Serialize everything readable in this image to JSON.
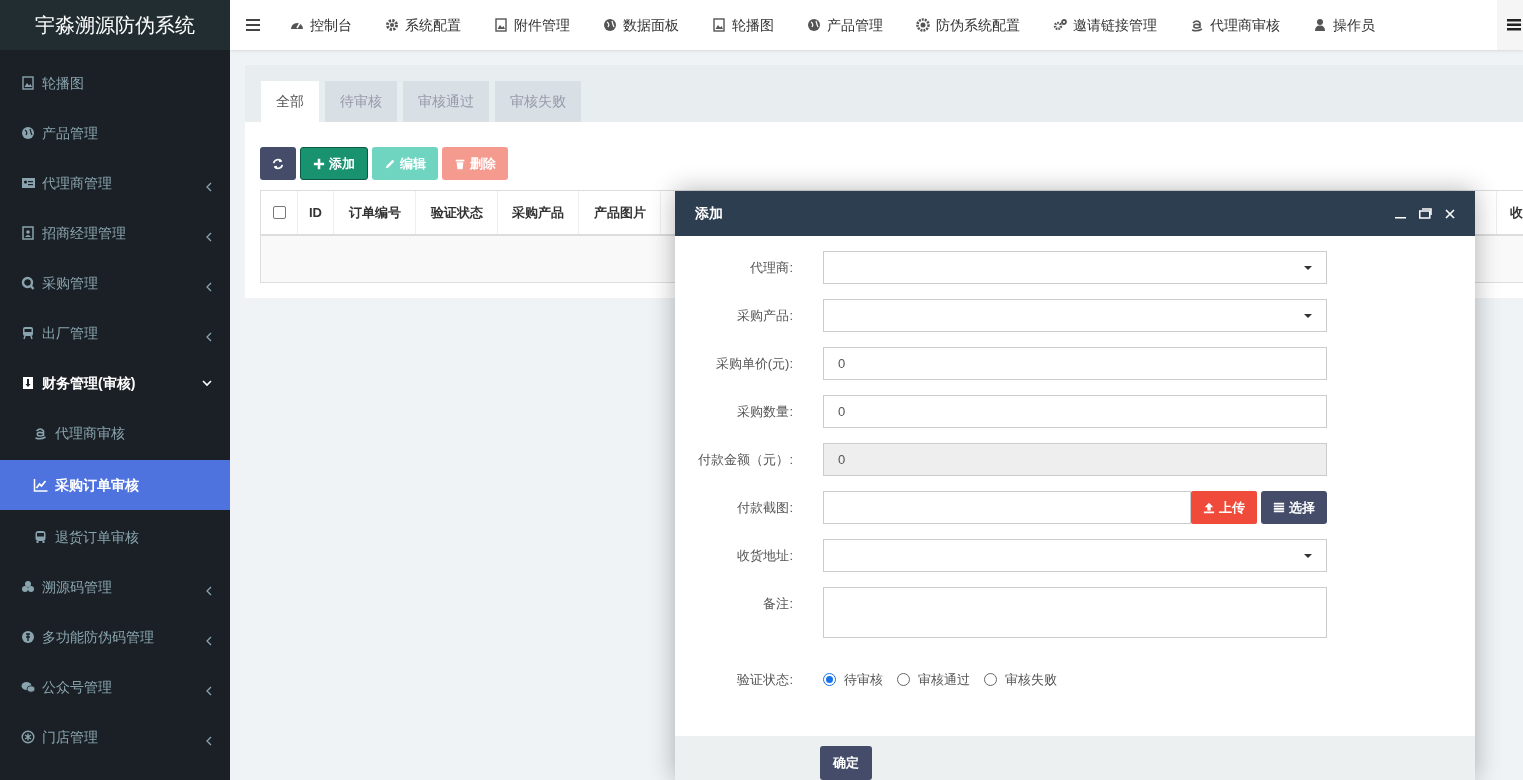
{
  "app_title": "宇淼溯源防伪系统",
  "top_nav": [
    {
      "label": "控制台"
    },
    {
      "label": "系统配置"
    },
    {
      "label": "附件管理"
    },
    {
      "label": "数据面板"
    },
    {
      "label": "轮播图"
    },
    {
      "label": "产品管理"
    },
    {
      "label": "防伪系统配置"
    },
    {
      "label": "邀请链接管理"
    },
    {
      "label": "代理商审核"
    },
    {
      "label": "操作员"
    }
  ],
  "sidebar": {
    "items": [
      {
        "kind": "link",
        "label": "轮播图"
      },
      {
        "kind": "link",
        "label": "产品管理"
      },
      {
        "kind": "group",
        "label": "代理商管理",
        "expanded": false
      },
      {
        "kind": "group",
        "label": "招商经理管理",
        "expanded": false
      },
      {
        "kind": "group",
        "label": "采购管理",
        "expanded": false
      },
      {
        "kind": "group",
        "label": "出厂管理",
        "expanded": false
      },
      {
        "kind": "group",
        "label": "财务管理(审核)",
        "expanded": true,
        "children": [
          {
            "label": "代理商审核",
            "selected": false
          },
          {
            "label": "采购订单审核",
            "selected": true
          },
          {
            "label": "退货订单审核",
            "selected": false
          }
        ]
      },
      {
        "kind": "group",
        "label": "溯源码管理",
        "expanded": false
      },
      {
        "kind": "group",
        "label": "多功能防伪码管理",
        "expanded": false
      },
      {
        "kind": "group",
        "label": "公众号管理",
        "expanded": false
      },
      {
        "kind": "group",
        "label": "门店管理",
        "expanded": false
      }
    ]
  },
  "tabs": [
    {
      "label": "全部",
      "selected": true
    },
    {
      "label": "待审核",
      "selected": false
    },
    {
      "label": "审核通过",
      "selected": false
    },
    {
      "label": "审核失败",
      "selected": false
    }
  ],
  "toolbar": [
    {
      "kind": "refresh",
      "disabled": false
    },
    {
      "kind": "add",
      "label": "添加",
      "disabled": false
    },
    {
      "kind": "edit",
      "label": "编辑",
      "disabled": true
    },
    {
      "kind": "delete",
      "label": "删除",
      "disabled": true
    }
  ],
  "table": {
    "select_all": {
      "checked": false
    },
    "columns": [
      "ID",
      "订单编号",
      "验证状态",
      "采购产品",
      "产品图片"
    ],
    "last_column": "收"
  },
  "dialog": {
    "title": "添加",
    "fields": [
      {
        "kind": "select",
        "label": "代理商:"
      },
      {
        "kind": "select",
        "label": "采购产品:"
      },
      {
        "kind": "input",
        "label": "采购单价(元):",
        "value": "0"
      },
      {
        "kind": "input",
        "label": "采购数量:",
        "value": "0"
      },
      {
        "kind": "readonly",
        "label": "付款金额（元）:",
        "value": "0"
      },
      {
        "kind": "upload",
        "label": "付款截图:",
        "buttons": [
          "上传",
          "选择"
        ]
      },
      {
        "kind": "select",
        "label": "收货地址:"
      },
      {
        "kind": "textarea",
        "label": "备注:"
      },
      {
        "kind": "radio",
        "label": "验证状态:",
        "options": [
          {
            "label": "待审核",
            "selected": true
          },
          {
            "label": "审核通过",
            "selected": false
          },
          {
            "label": "审核失败",
            "selected": false
          }
        ]
      }
    ],
    "submit": "确定"
  }
}
